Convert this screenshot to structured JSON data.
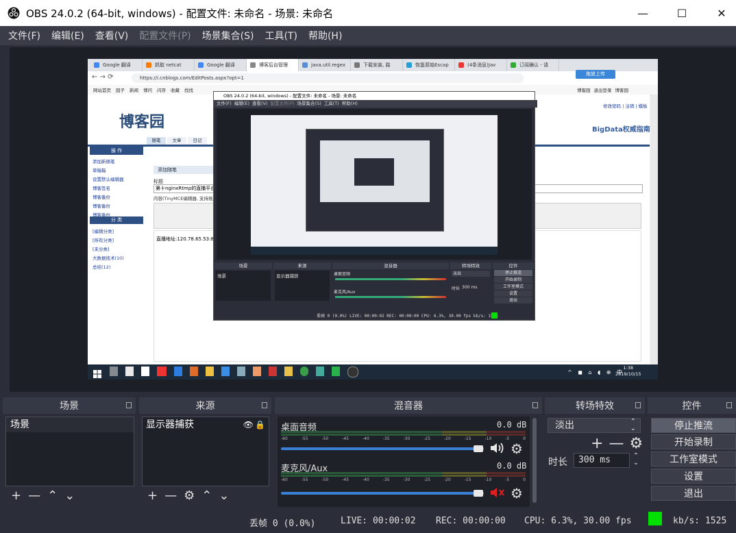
{
  "window": {
    "title": "OBS 24.0.2 (64-bit, windows) - 配置文件: 未命名 - 场景: 未命名",
    "minimize": "—",
    "maximize": "☐",
    "close": "✕"
  },
  "menubar": [
    {
      "label": "文件(F)",
      "enabled": true
    },
    {
      "label": "编辑(E)",
      "enabled": true
    },
    {
      "label": "查看(V)",
      "enabled": true
    },
    {
      "label": "配置文件(P)",
      "enabled": false
    },
    {
      "label": "场景集合(S)",
      "enabled": true
    },
    {
      "label": "工具(T)",
      "enabled": true
    },
    {
      "label": "帮助(H)",
      "enabled": true
    }
  ],
  "preview": {
    "browser": {
      "tabs": [
        "Google 翻译",
        "抓取 netcat",
        "Google 翻译",
        "博客后台管理",
        "java.util.regex",
        "下载安装, 路",
        "恢复原始Escap",
        "(4条消息)Jav",
        "订阅确认 - 请"
      ],
      "url": "https://i.cnblogs.com/EditPosts.aspx?opt=1",
      "nav_links": [
        "网站首页",
        "园子",
        "新闻",
        "博问",
        "闪存",
        "收藏",
        "找找"
      ],
      "right_links": [
        "博客园",
        "退出登录",
        "博客园"
      ],
      "site_logo": "博客园",
      "brand": "BigData权威指南",
      "top_right": "修改密码 | 注销 | 模板",
      "content_tabs": [
        "随笔",
        "文章",
        "日记"
      ],
      "sidebar_title": "操 作",
      "sidebar_links": [
        "添加新随笔",
        "草稿箱",
        "设置默认编辑器",
        "博客签名",
        "博客备份",
        "博客备份",
        "博客备份"
      ],
      "sidebar_title2": "分 类",
      "sidebar_links2": [
        "[编辑分类]",
        "[所有分类]",
        "[未分类]",
        "大数据技术(10)",
        "总结(12)"
      ],
      "section_label": "添加随笔",
      "field_label": "标题",
      "title_value": "第十nginxRtmp的直播平台",
      "content_label": "内容(TinyMCE编辑器, 支持拖放/粘贴上传图片)",
      "body_text": "直播地址:120.78.65.53:8",
      "upload_btn": "拖放上传",
      "clock_time": "1:38",
      "clock_date": "2019/10/15"
    },
    "inner_obs": {
      "title": "OBS 24.0.2 (64-bit, windows) - 配置文件: 未命名 - 场景: 未命名",
      "menu": [
        "文件(F)",
        "编辑(E)",
        "查看(V)",
        "配置文件(P)",
        "场景集合(S)",
        "工具(T)",
        "帮助(H)"
      ],
      "docks": [
        "场景",
        "来源",
        "混音器",
        "转场特效",
        "控件"
      ],
      "scene": "场景",
      "source": "显示器捕获",
      "mixer_tracks": [
        "桌面音频",
        "麦克风/Aux"
      ],
      "transition": "淡出",
      "duration_label": "时长",
      "duration": "300 ms",
      "controls": [
        "停止推流",
        "开始录制",
        "工作室模式",
        "设置",
        "退出"
      ],
      "status": "丢帧 0 (0.0%)   LIVE: 00:00:02   REC: 00:00:00   CPU: 6.3%, 30.00 fps   kb/s: 1525"
    }
  },
  "docks": {
    "scenes": {
      "title": "场景",
      "items": [
        "场景"
      ]
    },
    "sources": {
      "title": "来源",
      "items": [
        "显示器捕获"
      ]
    },
    "mixer": {
      "title": "混音器",
      "scale": [
        "-60",
        "-55",
        "-50",
        "-45",
        "-40",
        "-35",
        "-30",
        "-25",
        "-20",
        "-15",
        "-10",
        "-5",
        "0"
      ],
      "tracks": [
        {
          "name": "桌面音频",
          "db": "0.0 dB",
          "volume": 1.0,
          "muted": false
        },
        {
          "name": "麦克风/Aux",
          "db": "0.0 dB",
          "volume": 1.0,
          "muted": true
        }
      ]
    },
    "transitions": {
      "title": "转场特效",
      "selected": "淡出",
      "duration_label": "时长",
      "duration": "300 ms"
    },
    "controls": {
      "title": "控件",
      "buttons": [
        {
          "label": "停止推流",
          "active": true
        },
        {
          "label": "开始录制",
          "active": false
        },
        {
          "label": "工作室模式",
          "active": false
        },
        {
          "label": "设置",
          "active": false
        },
        {
          "label": "退出",
          "active": false
        }
      ]
    }
  },
  "status": {
    "dropped": "丢帧 0 (0.0%)",
    "live": "LIVE: 00:00:02",
    "rec": "REC: 00:00:00",
    "cpu": "CPU: 6.3%, 30.00 fps",
    "kbps": "kb/s: 1525",
    "indicator_color": "#00e000"
  },
  "colors": {
    "accent": "#3c7fd6",
    "mute": "#e02020"
  }
}
